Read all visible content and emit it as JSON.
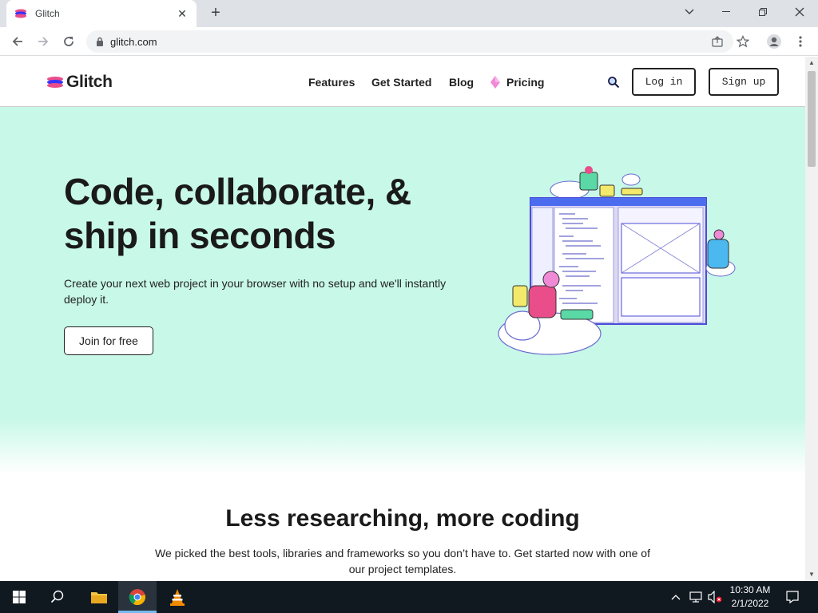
{
  "browser": {
    "tab_title": "Glitch",
    "url": "glitch.com"
  },
  "site": {
    "logo_text": "Glitch",
    "nav": {
      "features": "Features",
      "get_started": "Get Started",
      "blog": "Blog",
      "pricing": "Pricing"
    },
    "login_label": "Log in",
    "signup_label": "Sign up"
  },
  "hero": {
    "title": "Code, collaborate, & ship in seconds",
    "subtitle": "Create your next web project in your browser with no setup and we'll instantly deploy it.",
    "cta": "Join for free"
  },
  "section": {
    "title": "Less researching, more coding",
    "subtitle": "We picked the best tools, libraries and frameworks so you don’t have to. Get started now with one of our project templates."
  },
  "taskbar": {
    "time": "10:30 AM",
    "date": "2/1/2022"
  },
  "colors": {
    "hero_bg": "#c8f8e8",
    "taskbar_bg": "#101820",
    "tabstrip_bg": "#dee1e6"
  }
}
